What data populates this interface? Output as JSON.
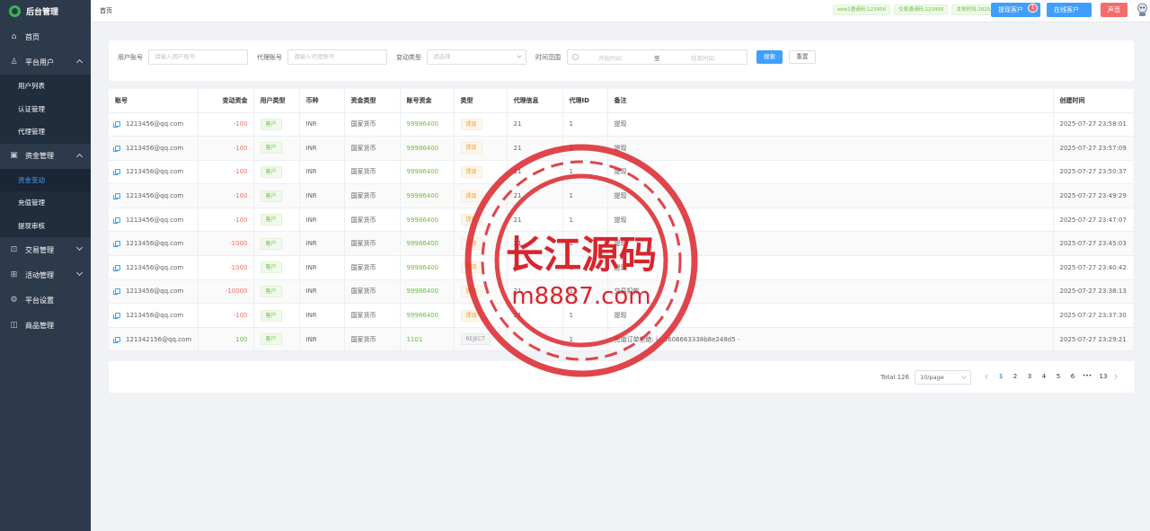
{
  "sidebar": {
    "brand": "后台管理",
    "items": [
      {
        "label": "首页",
        "icon": "home-icon"
      },
      {
        "label": "平台用户",
        "icon": "user-icon",
        "expanded": true,
        "children": [
          "用户列表",
          "认证管理",
          "代理管理"
        ]
      },
      {
        "label": "资金管理",
        "icon": "wallet-icon",
        "expanded": true,
        "children": [
          "资金变动",
          "充值管理",
          "提现审核"
        ],
        "active_child": "资金变动"
      },
      {
        "label": "交易管理",
        "icon": "cart-icon",
        "expanded": false
      },
      {
        "label": "活动管理",
        "icon": "gift-icon",
        "expanded": false
      },
      {
        "label": "平台设置",
        "icon": "gear-icon"
      },
      {
        "label": "商品管理",
        "icon": "bag-icon"
      }
    ]
  },
  "header": {
    "breadcrumb": "首页",
    "tags": [
      "web1邀请码:123456",
      "交易邀请码:123456",
      "本地时间:2025/9/16 13:53:40"
    ],
    "withdraw_btn": "提现客户",
    "withdraw_badge": "1",
    "online_btn": "在线客户",
    "sound_btn": "声音"
  },
  "filters": {
    "user_label": "用户账号",
    "user_placeholder": "请输入用户账号",
    "agent_label": "代理账号",
    "agent_placeholder": "请输入代理账号",
    "type_label": "变动类型",
    "type_placeholder": "请选择",
    "time_label": "时间范围",
    "start_placeholder": "开始时间",
    "range_sep": "至",
    "end_placeholder": "结束时间",
    "search_btn": "搜索",
    "reset_btn": "重置"
  },
  "table": {
    "headers": [
      "账号",
      "变动资金",
      "用户类型",
      "币种",
      "资金类型",
      "账号资金",
      "类型",
      "代理信息",
      "代理ID",
      "备注",
      "创建时间"
    ],
    "rows": [
      {
        "account": "1213456@qq.com",
        "change": "-100",
        "user_type": "客户",
        "currency": "INR",
        "fund_type": "国家货币",
        "balance": "99986400",
        "type": "提现",
        "agent": "21",
        "agent_id": "1",
        "remark": "提现",
        "time": "2025-07-27 23:58:01"
      },
      {
        "account": "1213456@qq.com",
        "change": "-100",
        "user_type": "客户",
        "currency": "INR",
        "fund_type": "国家货币",
        "balance": "99986400",
        "type": "提现",
        "agent": "21",
        "agent_id": "1",
        "remark": "提现",
        "time": "2025-07-27 23:57:09"
      },
      {
        "account": "1213456@qq.com",
        "change": "-100",
        "user_type": "客户",
        "currency": "INR",
        "fund_type": "国家货币",
        "balance": "99986400",
        "type": "提现",
        "agent": "21",
        "agent_id": "1",
        "remark": "提现",
        "time": "2025-07-27 23:50:37"
      },
      {
        "account": "1213456@qq.com",
        "change": "-100",
        "user_type": "客户",
        "currency": "INR",
        "fund_type": "国家货币",
        "balance": "99986400",
        "type": "提现",
        "agent": "21",
        "agent_id": "1",
        "remark": "提现",
        "time": "2025-07-27 23:49:29"
      },
      {
        "account": "1213456@qq.com",
        "change": "-100",
        "user_type": "客户",
        "currency": "INR",
        "fund_type": "国家货币",
        "balance": "99986400",
        "type": "提现",
        "agent": "21",
        "agent_id": "1",
        "remark": "提现",
        "time": "2025-07-27 23:47:07"
      },
      {
        "account": "1213456@qq.com",
        "change": "-1000",
        "user_type": "客户",
        "currency": "INR",
        "fund_type": "国家货币",
        "balance": "99986400",
        "type": "提现",
        "agent": "21",
        "agent_id": "1",
        "remark": "提现",
        "time": "2025-07-27 23:45:03"
      },
      {
        "account": "1213456@qq.com",
        "change": "-1000",
        "user_type": "客户",
        "currency": "INR",
        "fund_type": "国家货币",
        "balance": "99986400",
        "type": "提现",
        "agent": "21",
        "agent_id": "1",
        "remark": "提现",
        "time": "2025-07-27 23:40:42"
      },
      {
        "account": "1213456@qq.com",
        "change": "-10000",
        "user_type": "客户",
        "currency": "INR",
        "fund_type": "国家货币",
        "balance": "99986400",
        "type": "提现",
        "agent": "21",
        "agent_id": "1",
        "remark": "交易扣款",
        "time": "2025-07-27 23:38:13"
      },
      {
        "account": "1213456@qq.com",
        "change": "-100",
        "user_type": "客户",
        "currency": "INR",
        "fund_type": "国家货币",
        "balance": "99986400",
        "type": "提现",
        "agent": "21",
        "agent_id": "1",
        "remark": "提现",
        "time": "2025-07-27 23:37:30"
      },
      {
        "account": "121342156@qq.com",
        "change": "100",
        "user_type": "客户",
        "currency": "INR",
        "fund_type": "国家货币",
        "balance": "1101",
        "type": "REJECT",
        "agent": "",
        "agent_id": "1",
        "remark": "充值订单拒绝: i...3606663338b8e248d5 -",
        "time": "2025-07-27 23:29:21"
      }
    ]
  },
  "pagination": {
    "total": "Total 126",
    "page_size": "10/page",
    "pages": [
      "1",
      "2",
      "3",
      "4",
      "5",
      "6",
      "•••",
      "13"
    ],
    "current": "1"
  },
  "watermark": {
    "line1": "长江源码",
    "line2": "m8887.com",
    "color": "#d9252c"
  }
}
